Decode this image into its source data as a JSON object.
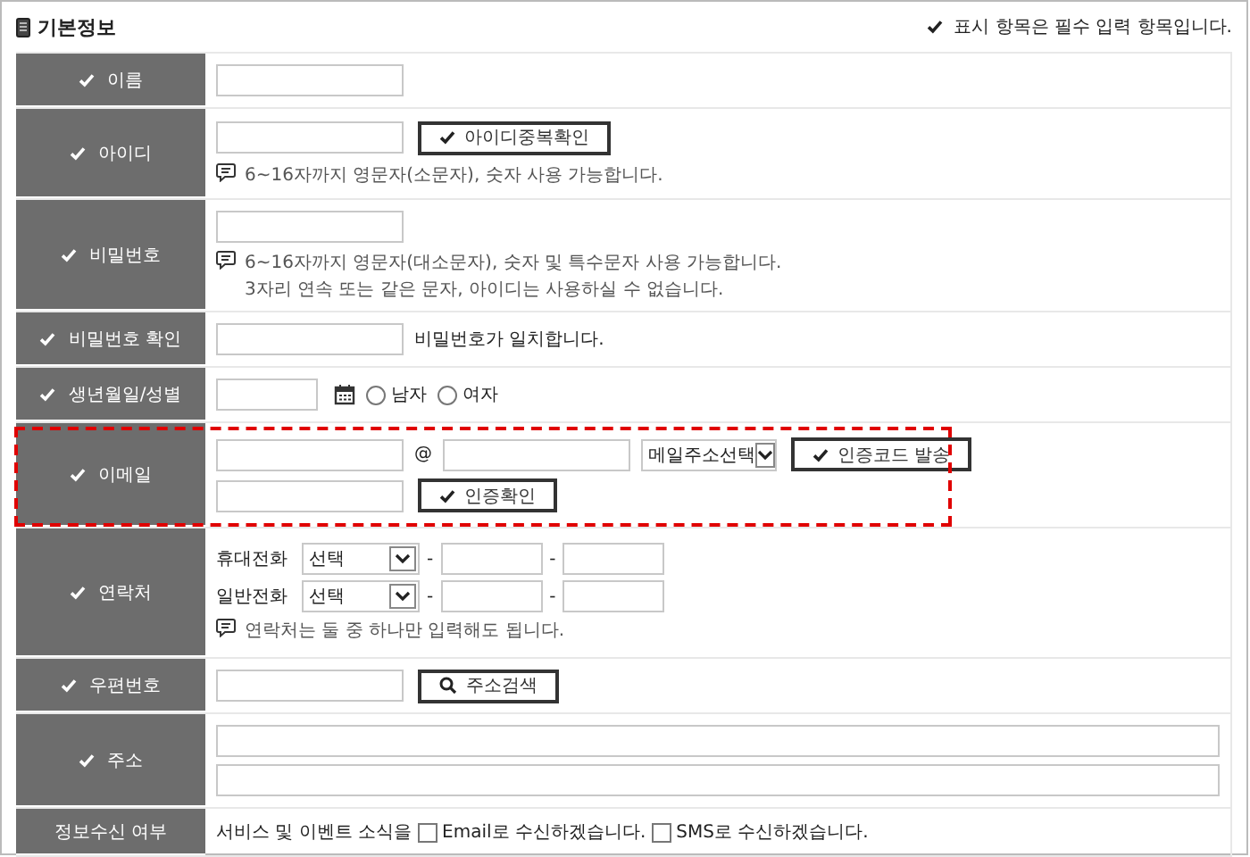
{
  "header": {
    "title": "기본정보",
    "note": "표시 항목은 필수 입력 항목입니다."
  },
  "rows": [
    {
      "kind": "text",
      "label": "이름",
      "required": true
    },
    {
      "kind": "id",
      "label": "아이디",
      "required": true,
      "button": "아이디중복확인",
      "hints": [
        "6~16자까지 영문자(소문자), 숫자 사용 가능합니다."
      ]
    },
    {
      "kind": "password",
      "label": "비밀번호",
      "required": true,
      "hints": [
        "6~16자까지 영문자(대소문자), 숫자 및 특수문자 사용 가능합니다.",
        "3자리 연속 또는 같은 문자, 아이디는 사용하실 수 없습니다."
      ]
    },
    {
      "kind": "confirm",
      "label": "비밀번호 확인",
      "required": true,
      "message": "비밀번호가 일치합니다."
    },
    {
      "kind": "birth",
      "label": "생년월일/성별",
      "required": true,
      "options": [
        {
          "label": "남자",
          "selected": false
        },
        {
          "label": "여자",
          "selected": false
        }
      ]
    },
    {
      "kind": "email",
      "label": "이메일",
      "required": true,
      "highlighted": true,
      "at": "@",
      "domain_select": "메일주소선택",
      "send_button": "인증코드 발송",
      "verify_button": "인증확인"
    },
    {
      "kind": "phone",
      "label": "연락처",
      "required": true,
      "lines": [
        {
          "label": "휴대전화",
          "select": "선택",
          "separators": [
            "-",
            "-"
          ]
        },
        {
          "label": "일반전화",
          "select": "선택",
          "separators": [
            "-",
            "-"
          ]
        }
      ],
      "hint": "연락처는 둘 중 하나만 입력해도 됩니다."
    },
    {
      "kind": "zip",
      "label": "우편번호",
      "required": true,
      "button": "주소검색"
    },
    {
      "kind": "address",
      "label": "주소",
      "required": true
    },
    {
      "kind": "consent",
      "label": "정보수신 여부",
      "required": false,
      "lead": "서비스 및 이벤트 소식을",
      "options": [
        {
          "label": "Email로 수신하겠습니다.",
          "checked": false
        },
        {
          "label": "SMS로 수신하겠습니다.",
          "checked": false
        }
      ]
    }
  ]
}
